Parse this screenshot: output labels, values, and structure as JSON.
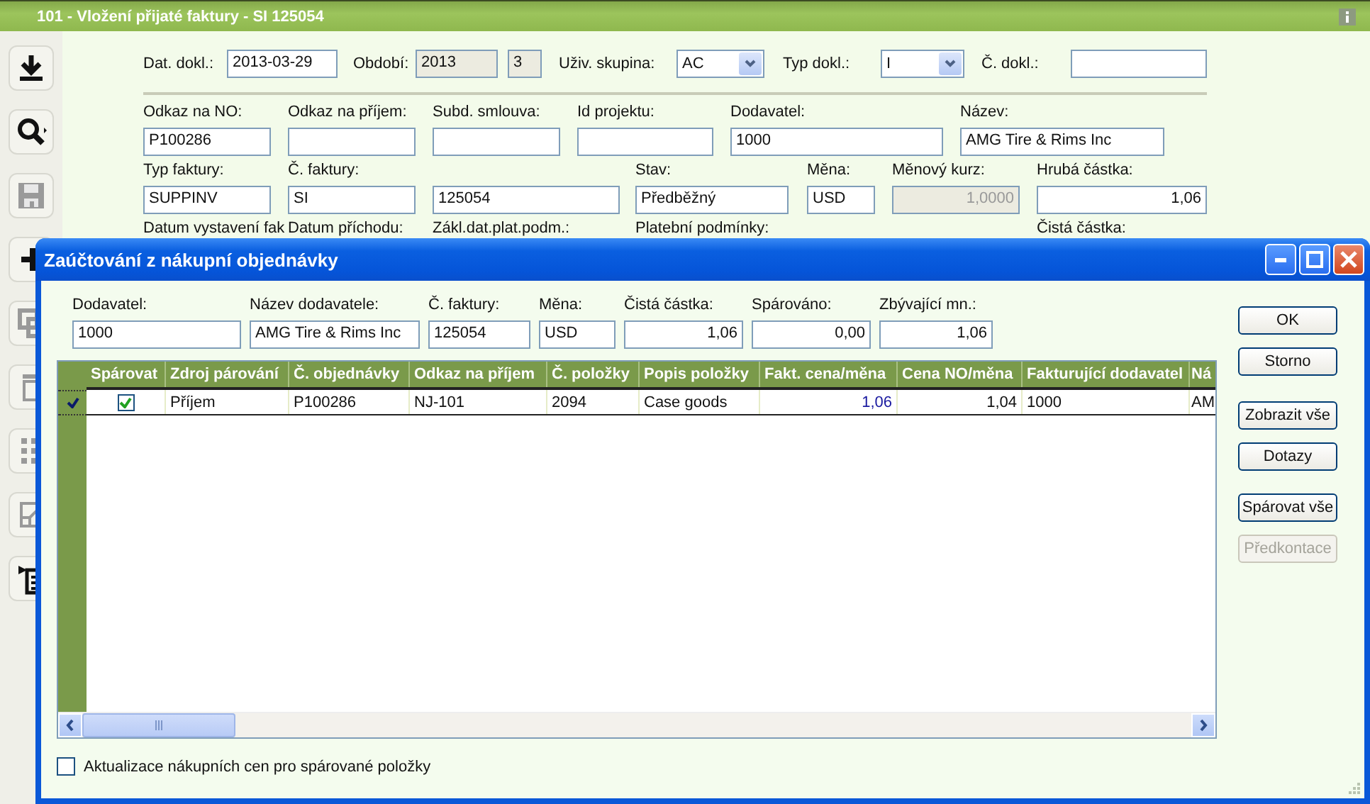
{
  "window": {
    "title": "101 - Vložení přijaté faktury - SI 125054"
  },
  "toolbar": [
    {
      "kind": "download"
    },
    {
      "kind": "search"
    },
    {
      "kind": "save"
    },
    {
      "kind": "add"
    },
    {
      "kind": "copy"
    },
    {
      "kind": "delete"
    },
    {
      "kind": "list"
    },
    {
      "kind": "export"
    },
    {
      "kind": "report"
    }
  ],
  "top_row": [
    {
      "kind": "label",
      "text": "Dat. dokl.:"
    },
    {
      "kind": "input",
      "value": "2013-03-29",
      "disabled": false
    },
    {
      "kind": "label",
      "text": "Období:"
    },
    {
      "kind": "input",
      "value": "2013",
      "disabled": true
    },
    {
      "kind": "input",
      "value": "3",
      "disabled": true
    },
    {
      "kind": "label",
      "text": "Uživ. skupina:"
    },
    {
      "kind": "combo",
      "value": "AC"
    },
    {
      "kind": "label",
      "text": "Typ dokl.:"
    },
    {
      "kind": "combo",
      "value": "I"
    },
    {
      "kind": "label",
      "text": "Č. dokl.:"
    },
    {
      "kind": "input",
      "disabled": false
    }
  ],
  "fields_row_1": [
    {
      "label": "Odkaz na NO:",
      "value": "P100286",
      "kind": "text",
      "disabled": false
    },
    {
      "label": "Odkaz na příjem:",
      "kind": "text",
      "disabled": false
    },
    {
      "label": "Subd. smlouva:",
      "kind": "text",
      "disabled": false
    },
    {
      "label": "Id projektu:",
      "kind": "text",
      "disabled": false
    },
    {
      "label": "Dodavatel:",
      "value": "1000",
      "kind": "text",
      "disabled": false
    },
    {
      "label": "Název:",
      "value": "AMG Tire & Rims Inc",
      "kind": "text",
      "disabled": false
    }
  ],
  "fields_row_2": [
    {
      "label": "Typ faktury:",
      "value": "SUPPINV",
      "kind": "text",
      "disabled": false
    },
    {
      "label": "Č. faktury:",
      "value": "SI",
      "kind": "text",
      "disabled": false
    },
    {
      "value": "125054",
      "kind": "text",
      "disabled": false
    },
    {
      "label": "Stav:",
      "value": "Předběžný",
      "kind": "text",
      "disabled": false
    },
    {
      "label": "Měna:",
      "value": "USD",
      "kind": "text",
      "disabled": false
    },
    {
      "label": "Měnový kurz:",
      "value": "1,0000",
      "kind": "amount",
      "disabled": true
    },
    {
      "label": "Hrubá částka:",
      "value": "1,06",
      "kind": "amount",
      "disabled": false
    }
  ],
  "fields_row_3_labels": [
    "Datum vystavení fak",
    "Datum příchodu:",
    "Zákl.dat.plat.podm.:",
    "Platební podmínky:",
    "Čistá částka:"
  ],
  "dialog": {
    "title": "Zaúčtování z nákupní objednávky",
    "fields": [
      {
        "label": "Dodavatel:",
        "value": "1000",
        "kind": "text"
      },
      {
        "label": "Název dodavatele:",
        "value": "AMG Tire & Rims Inc",
        "kind": "text"
      },
      {
        "label": "Č. faktury:",
        "value": "125054",
        "kind": "text"
      },
      {
        "label": "Měna:",
        "value": "USD",
        "kind": "text"
      },
      {
        "label": "Čistá částka:",
        "value": "1,06",
        "kind": "amount"
      },
      {
        "label": "Spárováno:",
        "value": "0,00",
        "kind": "amount"
      },
      {
        "label": "Zbývající mn.:",
        "value": "1,06",
        "kind": "amount"
      }
    ],
    "grid": {
      "columns": [
        {
          "label": "Spárovat",
          "kind": "check"
        },
        {
          "label": "Zdroj párování",
          "kind": "text"
        },
        {
          "label": "Č. objednávky",
          "kind": "text"
        },
        {
          "label": "Odkaz na příjem",
          "kind": "text"
        },
        {
          "label": "Č. položky",
          "kind": "text"
        },
        {
          "label": "Popis položky",
          "kind": "text"
        },
        {
          "label": "Fakt. cena/měna",
          "kind": "editable_amount"
        },
        {
          "label": "Cena NO/měna",
          "kind": "amount"
        },
        {
          "label": "Fakturující dodavatel",
          "kind": "text"
        },
        {
          "label": "Ná",
          "kind": "text"
        }
      ],
      "rows": [
        {
          "selected": true,
          "checked": true,
          "cells": [
            "",
            "Příjem",
            "P100286",
            "NJ-101",
            "2094",
            "Case goods",
            "1,06",
            "1,04",
            "1000",
            "AM"
          ]
        }
      ]
    },
    "buttons": [
      {
        "label": "OK",
        "disabled": false
      },
      {
        "label": "Storno",
        "disabled": false
      },
      {
        "label": "Zobrazit vše",
        "disabled": false
      },
      {
        "label": "Dotazy",
        "disabled": false
      },
      {
        "label": "Spárovat vše",
        "disabled": false
      },
      {
        "label": "Předkontace",
        "disabled": true
      }
    ],
    "option": {
      "label": "Aktualizace nákupních cen pro spárované položky",
      "checked": false
    }
  }
}
